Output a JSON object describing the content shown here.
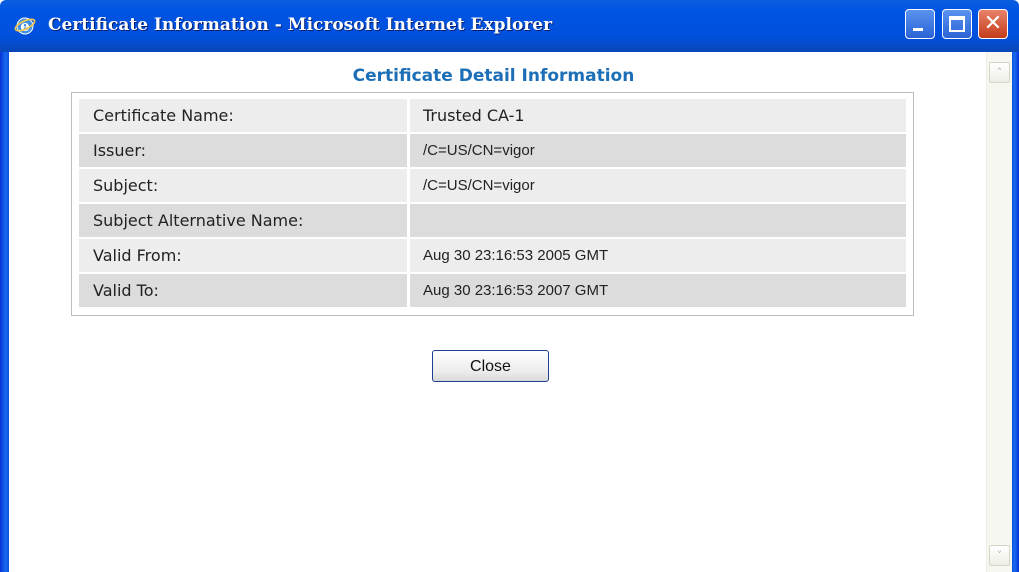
{
  "window": {
    "title": "Certificate Information - Microsoft Internet Explorer",
    "icon": "internet-explorer-icon",
    "controls": {
      "minimize": "minimize-icon",
      "maximize": "maximize-icon",
      "close_glyph": "✕"
    }
  },
  "page": {
    "heading": "Certificate Detail Information",
    "rows": [
      {
        "label": "Certificate Name:",
        "value": "Trusted CA-1"
      },
      {
        "label": "Issuer:",
        "value": "/C=US/CN=vigor"
      },
      {
        "label": "Subject:",
        "value": "/C=US/CN=vigor"
      },
      {
        "label": "Subject Alternative Name:",
        "value": ""
      },
      {
        "label": "Valid From:",
        "value": "Aug 30 23:16:53 2005 GMT"
      },
      {
        "label": "Valid To:",
        "value": "Aug 30 23:16:53 2007 GMT"
      }
    ],
    "close_label": "Close"
  },
  "scrollbar": {
    "up_glyph": "˄",
    "down_glyph": "˅"
  },
  "colors": {
    "titlebar": "#0054e3",
    "heading": "#1c6fb6",
    "row_light": "#ededed",
    "row_dark": "#dcdcdc"
  }
}
